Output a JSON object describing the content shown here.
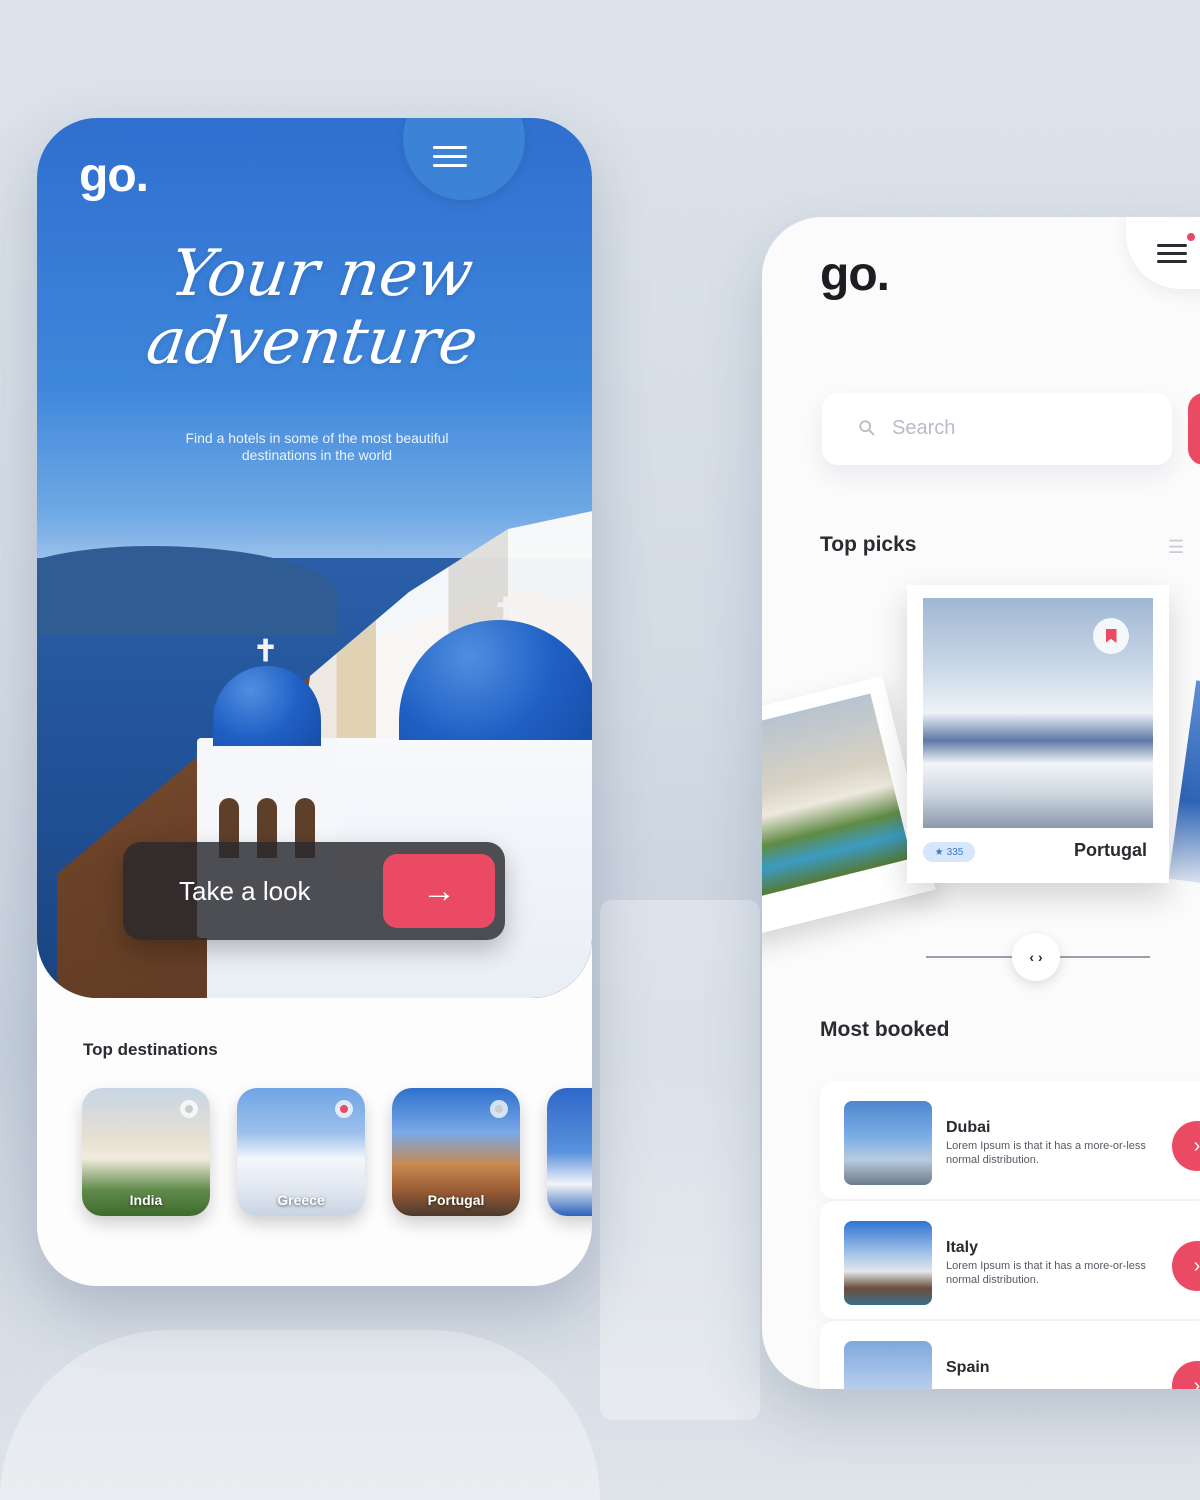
{
  "left_screen": {
    "logo": "go.",
    "hero_title_line1": "Your new",
    "hero_title_line2": "adventure",
    "hero_subtitle_line1": "Find a hotels in some of the most beautiful",
    "hero_subtitle_line2": "destinations in the world",
    "cta_label": "Take a look",
    "cta_icon": "arrow-right-icon",
    "top_destinations_title": "Top destinations",
    "destinations": [
      {
        "label": "India",
        "selected": false
      },
      {
        "label": "Greece",
        "selected": true
      },
      {
        "label": "Portugal",
        "selected": false
      },
      {
        "label": "",
        "selected": false
      }
    ]
  },
  "right_screen": {
    "logo": "go.",
    "search_placeholder": "Search",
    "top_picks_title": "Top picks",
    "top_picks": [
      {
        "name": "",
        "rating": ""
      },
      {
        "name": "Portugal",
        "rating": "335"
      }
    ],
    "most_booked_title": "Most booked",
    "most_booked": [
      {
        "name": "Dubai",
        "description": "Lorem Ipsum is that it has a more-or-less normal distribution."
      },
      {
        "name": "Italy",
        "description": "Lorem Ipsum is that it has a more-or-less normal distribution."
      },
      {
        "name": "Spain",
        "description": ""
      }
    ]
  },
  "colors": {
    "accent": "#ea4a63",
    "primary_blue": "#3c82d6",
    "text_dark": "#2a2a30"
  }
}
